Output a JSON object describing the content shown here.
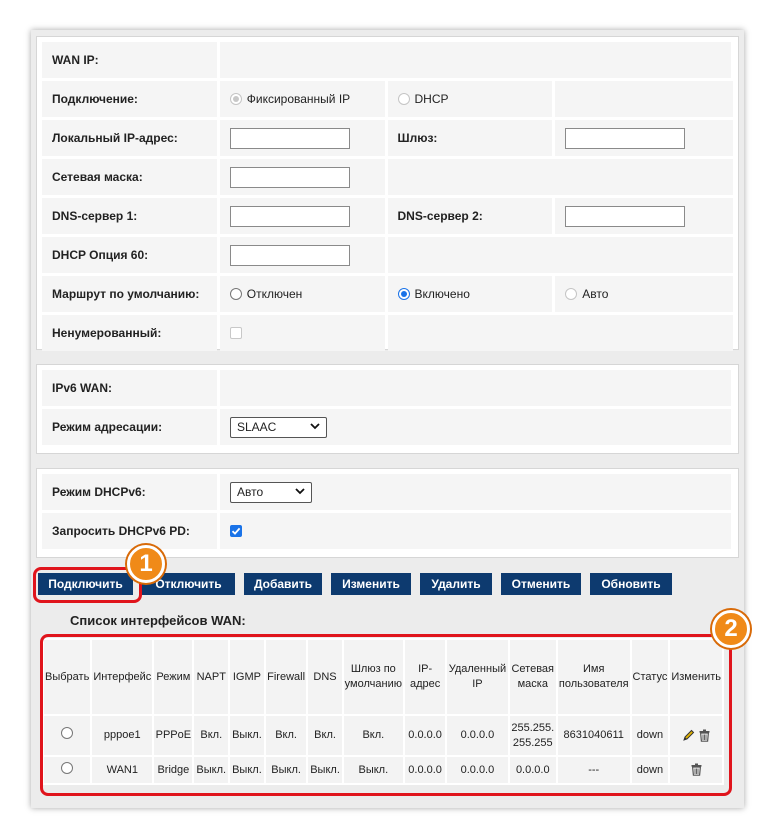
{
  "wan_ip": {
    "header": "WAN IP:",
    "connection": {
      "label": "Подключение:",
      "fixed_label": "Фиксированный IP",
      "dhcp_label": "DHCP"
    },
    "local_ip": {
      "label": "Локальный IP-адрес:",
      "value": ""
    },
    "gateway": {
      "label": "Шлюз:",
      "value": ""
    },
    "netmask": {
      "label": "Сетевая маска:",
      "value": ""
    },
    "dns1": {
      "label": "DNS-сервер 1:",
      "value": ""
    },
    "dns2": {
      "label": "DNS-сервер 2:",
      "value": ""
    },
    "dhcp_opt60": {
      "label": "DHCP Опция 60:",
      "value": ""
    },
    "default_route": {
      "label": "Маршрут по умолчанию:",
      "off_label": "Отключен",
      "on_label": "Включено",
      "auto_label": "Авто"
    },
    "unnumbered": {
      "label": "Ненумерованный:"
    }
  },
  "ipv6_wan": {
    "header": "IPv6 WAN:",
    "addr_mode": {
      "label": "Режим адресации:",
      "value": "SLAAC"
    }
  },
  "dhcpv6": {
    "mode": {
      "label": "Режим DHCPv6:",
      "value": "Авто"
    },
    "request_pd": {
      "label": "Запросить DHCPv6 PD:",
      "checked": true
    }
  },
  "toolbar": {
    "connect": "Подключить",
    "disconnect": "Отключить",
    "add": "Добавить",
    "modify": "Изменить",
    "delete": "Удалить",
    "cancel": "Отменить",
    "refresh": "Обновить"
  },
  "wan_list": {
    "title": "Список интерфейсов WAN:",
    "columns": [
      "Выбрать",
      "Интерфейс",
      "Режим",
      "NAPT",
      "IGMP",
      "Firewall",
      "DNS",
      "Шлюз по умолчанию",
      "IP-адрес",
      "Удаленный IP",
      "Сетевая маска",
      "Имя пользователя",
      "Статус",
      "Изменить"
    ],
    "rows": [
      {
        "iface": "pppoe1",
        "mode": "PPPoE",
        "napt": "Вкл.",
        "igmp": "Выкл.",
        "firewall": "Вкл.",
        "dns": "Вкл.",
        "gw": "Вкл.",
        "ip": "0.0.0.0",
        "remote_ip": "0.0.0.0",
        "mask": "255.255.255.255",
        "user": "8631040611",
        "status": "down"
      },
      {
        "iface": "WAN1",
        "mode": "Bridge",
        "napt": "Выкл.",
        "igmp": "Выкл.",
        "firewall": "Выкл.",
        "dns": "Выкл.",
        "gw": "Выкл.",
        "ip": "0.0.0.0",
        "remote_ip": "0.0.0.0",
        "mask": "0.0.0.0",
        "user": "---",
        "status": "down"
      }
    ]
  },
  "annotations": {
    "badge1": "1",
    "badge2": "2"
  },
  "colors": {
    "button_bg": "#0d3a6f",
    "annotation_red": "#e0141c",
    "badge_orange": "#f08a18",
    "checkbox_blue": "#1a73e8"
  }
}
